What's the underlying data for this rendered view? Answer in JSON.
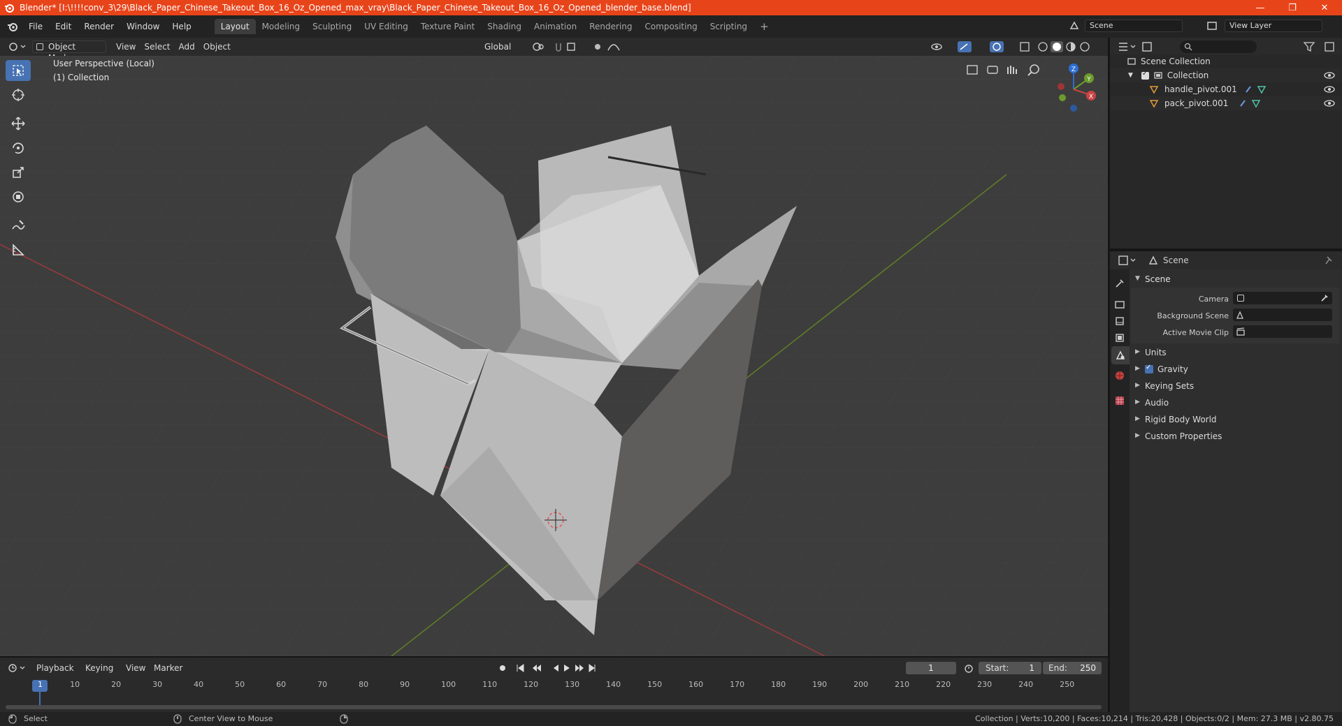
{
  "window": {
    "title": "Blender* [I:\\!!!!conv_3\\29\\Black_Paper_Chinese_Takeout_Box_16_Oz_Opened_max_vray\\Black_Paper_Chinese_Takeout_Box_16_Oz_Opened_blender_base.blend]",
    "minimize": "—",
    "maximize": "❐",
    "close": "✕"
  },
  "menu": [
    "File",
    "Edit",
    "Render",
    "Window",
    "Help"
  ],
  "workspaces": [
    "Layout",
    "Modeling",
    "Sculpting",
    "UV Editing",
    "Texture Paint",
    "Shading",
    "Animation",
    "Rendering",
    "Compositing",
    "Scripting"
  ],
  "workspace_add": "+",
  "scene_field": "Scene",
  "view_layer_field": "View Layer",
  "viewport_header": {
    "mode": "Object Mode",
    "menus": [
      "View",
      "Select",
      "Add",
      "Object"
    ],
    "transform": "Global"
  },
  "viewport": {
    "perspective": "User Perspective (Local)",
    "collection": "(1) Collection",
    "gizmo": {
      "x": "X",
      "y": "Y",
      "z": "Z"
    }
  },
  "outliner": {
    "scene_collection": "Scene Collection",
    "collection": "Collection",
    "objects": [
      "handle_pivot.001",
      "pack_pivot.001"
    ]
  },
  "properties": {
    "header": "Scene",
    "panel": "Scene",
    "fields": [
      {
        "label": "Camera"
      },
      {
        "label": "Background Scene"
      },
      {
        "label": "Active Movie Clip"
      }
    ],
    "sections": [
      "Units",
      "Gravity",
      "Keying Sets",
      "Audio",
      "Rigid Body World",
      "Custom Properties"
    ],
    "gravity_checked": true
  },
  "timeline": {
    "menus": [
      "Playback",
      "Keying",
      "View",
      "Marker"
    ],
    "current_frame": "1",
    "start_label": "Start:",
    "start": "1",
    "end_label": "End:",
    "end": "250",
    "ruler": [
      "1",
      "10",
      "20",
      "30",
      "40",
      "50",
      "60",
      "70",
      "80",
      "90",
      "100",
      "110",
      "120",
      "130",
      "140",
      "150",
      "160",
      "170",
      "180",
      "190",
      "200",
      "210",
      "220",
      "230",
      "240",
      "250"
    ]
  },
  "statusbar": {
    "select": "Select",
    "center": "Center View to Mouse",
    "stats": "Collection | Verts:10,200 | Faces:10,214 | Tris:20,428 | Objects:0/2 | Mem: 27.3 MB | v2.80.75"
  },
  "colors": {
    "accent": "#4772b3",
    "titlebar": "#e8441a",
    "x_axis": "#b83c3c",
    "y_axis": "#6c8b2b",
    "z_axis": "#2c6fd6"
  }
}
